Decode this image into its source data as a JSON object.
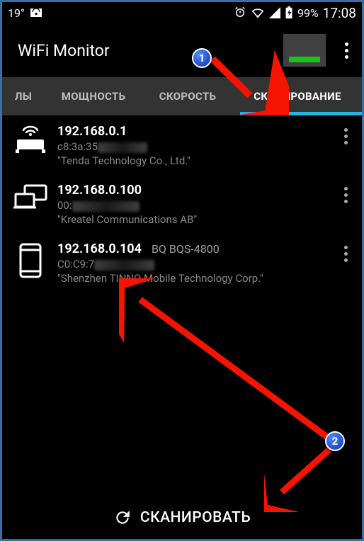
{
  "status": {
    "temperature": "19°",
    "battery_pct": "99%",
    "clock": "17:08"
  },
  "app_bar": {
    "title": "WiFi Monitor"
  },
  "tabs": {
    "t0": "ЛЫ",
    "t1": "МОЩНОСТЬ",
    "t2": "СКОРОСТЬ",
    "t3": "СКАНИРОВАНИЕ"
  },
  "devices": [
    {
      "ip": "192.168.0.1",
      "mac_prefix": "c8:3a:35",
      "vendor": "\"Tenda Technology Co., Ltd.\"",
      "icon": "router"
    },
    {
      "ip": "192.168.0.100",
      "mac_prefix": "00:",
      "vendor": "\"Kreatel Communications AB\"",
      "icon": "laptop"
    },
    {
      "ip": "192.168.0.104",
      "model": "BQ BQS-4800",
      "mac_prefix": "C0:C9:7",
      "vendor": "\"Shenzhen TINNO Mobile Technology Corp.\"",
      "icon": "phone"
    }
  ],
  "scan_button": {
    "label": "СКАНИРОВАТЬ"
  },
  "callouts": {
    "one": "1",
    "two": "2"
  }
}
